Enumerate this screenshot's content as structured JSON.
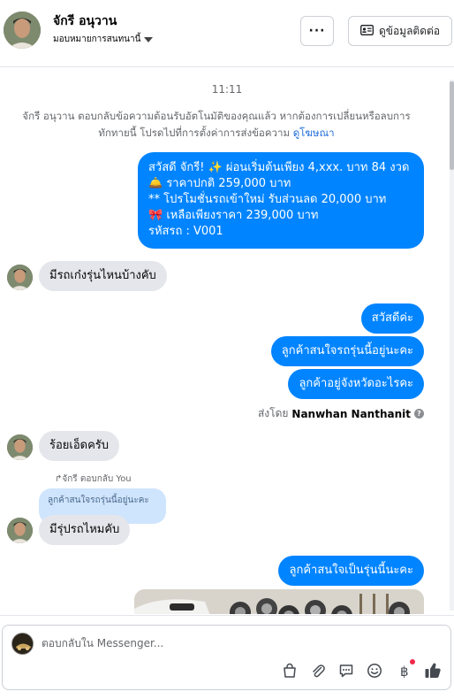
{
  "header": {
    "contact_name": "จักรี อนุวาน",
    "assign_label": "มอบหมายการสนทนานี้",
    "more_label": "···",
    "info_button_label": "ดูข้อมูลติดต่อ"
  },
  "thread": {
    "time": "11:11",
    "auto_note": "จักรี อนุวาน ตอบกลับข้อความต้อนรับอัตโนมัติของคุณแล้ว หากต้องการเปลี่ยนหรือลบการทักทายนี้ โปรดไปที่การตั้งค่าการส่งข้อความ",
    "auto_note_link": "ดูโฆษณา",
    "promo_lines": [
      "สวัสดี จักรี! ✨  ผ่อนเริ่มต้นเพียง 4,xxx. บาท 84 งวด",
      "🛎️ ราคาปกติ 259,000 บาท",
      "** โปรโมชั่นรถเข้าใหม่ รับส่วนลด 20,000 บาท",
      "🎀  เหลือเพียงราคา 239,000 บาท",
      " รหัสรถ : V001"
    ],
    "msg_in_1": "มีรถเก๋งรุ่นไหนบ้างคับ",
    "msg_out_1": "สวัสดีค่ะ",
    "msg_out_2": "ลูกค้าสนใจรถรุ่นนี้อยู่นะคะ",
    "msg_out_3": "ลูกค้าอยู่จังหวัดอะไรคะ",
    "sent_by_prefix": "ส่งโดย",
    "sent_by_name": "Nanwhan Nanthanit",
    "msg_in_2": "ร้อยเอ็ดครับ",
    "reply_meta": "จักรี ตอบกลับ You",
    "quoted_text": "ลูกค้าสนใจรถรุ่นนี้อยู่นะคะ",
    "msg_in_3": "มีรุ่ปรถไหมคับ",
    "msg_out_4": "ลูกค้าสนใจเป็นรุ่นนี้นะคะ"
  },
  "composer": {
    "placeholder": "ตอบกลับใน Messenger..."
  },
  "colors": {
    "accent": "#0084ff",
    "incoming_bubble": "#e4e6eb",
    "quoted_bubble": "#cfe4fd",
    "notification_dot": "#f02849"
  },
  "icons": [
    "more-icon",
    "contact-card-icon",
    "shopping-bag-icon",
    "paperclip-icon",
    "saved-reply-icon",
    "emoji-icon",
    "baht-icon",
    "like-icon"
  ]
}
